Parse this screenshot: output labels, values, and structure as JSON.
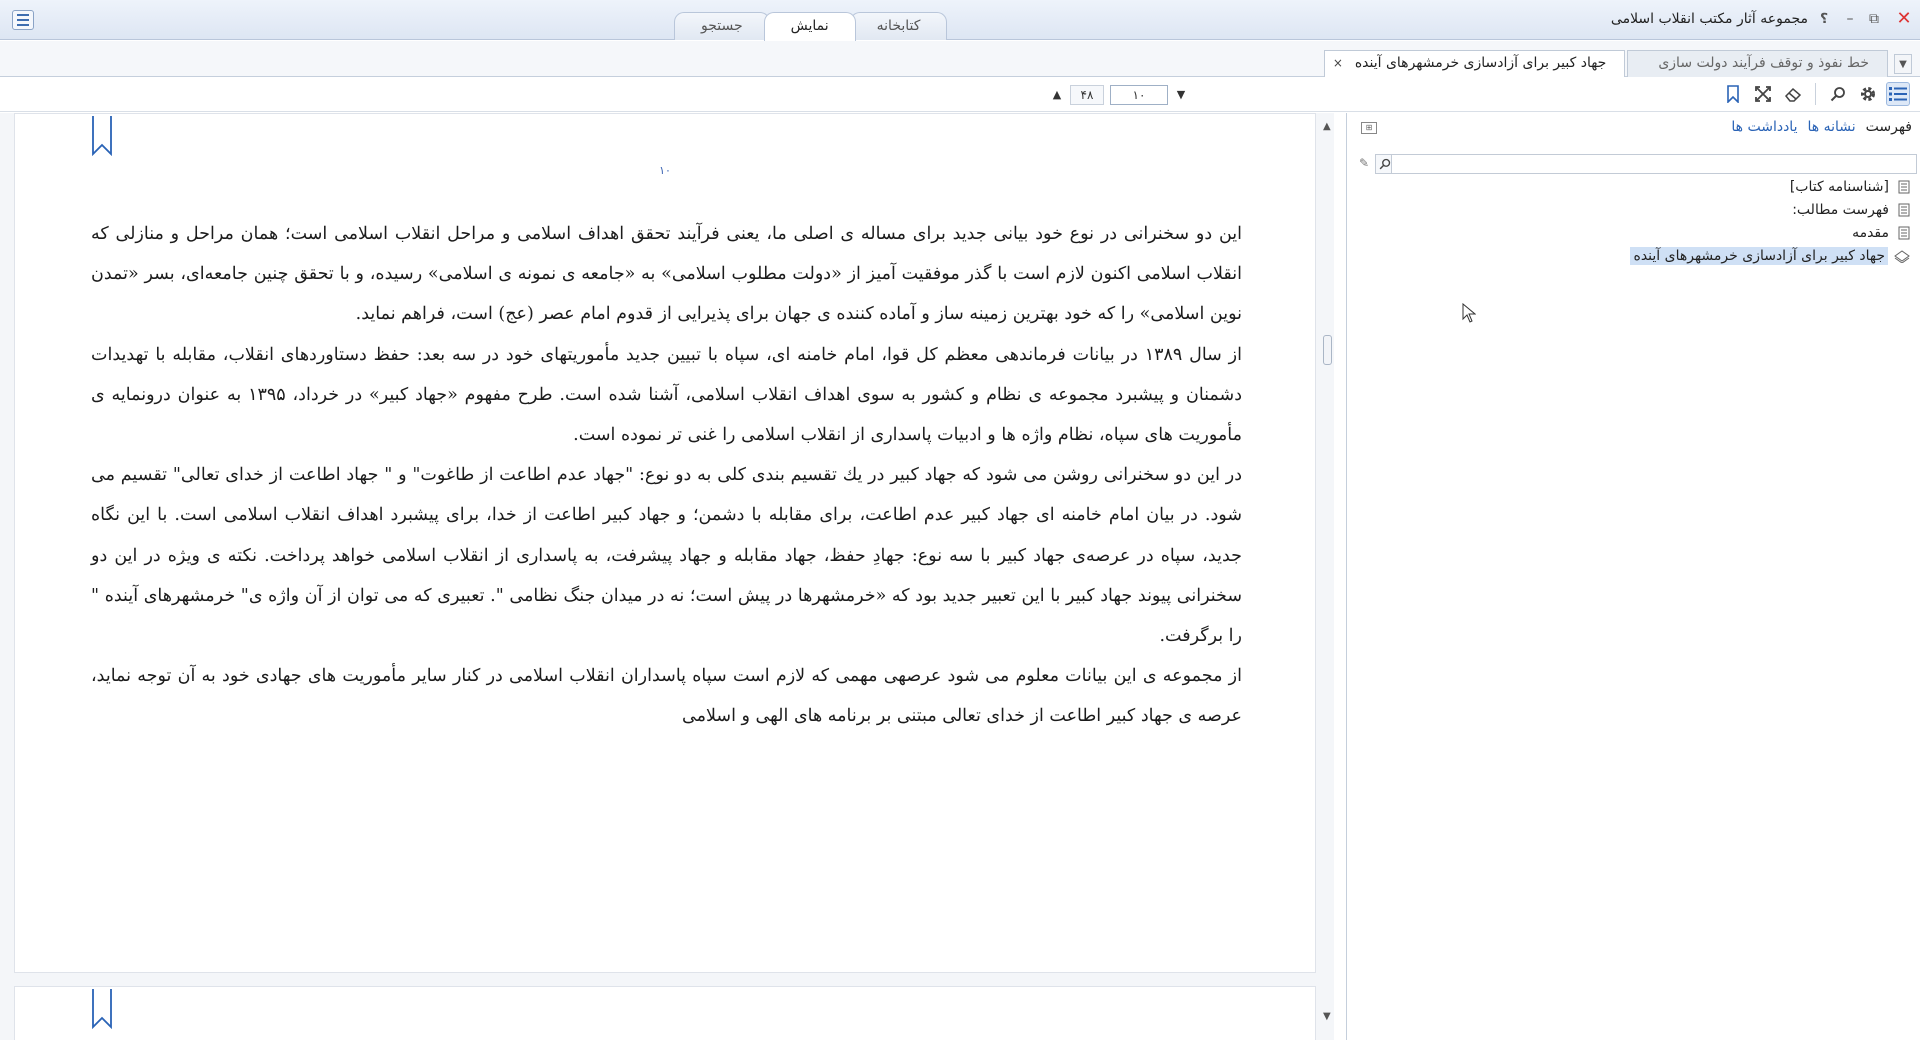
{
  "titlebar": {
    "app_title": "مجموعه آثار مکتب انقلاب اسلامی",
    "tabs": [
      {
        "label": "کتابخانه",
        "active": false
      },
      {
        "label": "نمایش",
        "active": true
      },
      {
        "label": "جستجو",
        "active": false
      }
    ],
    "help_glyph": "؟",
    "minimize_glyph": "–",
    "maximize_glyph": "⧉",
    "close_glyph": "✕"
  },
  "doc_tabs": [
    {
      "label": "جهاد کبیر برای آزادسازی خرمشهرهای آینده",
      "active": true,
      "close": "×"
    },
    {
      "label": "خط نفوذ و توقف فرآیند دولت سازی",
      "active": false,
      "close": ""
    }
  ],
  "toolbar": {
    "page_total": "۴۸",
    "page_current": "۱۰",
    "up_glyph": "▲",
    "down_glyph": "▼"
  },
  "reader": {
    "page_number": "۱۰",
    "paragraphs": [
      "این دو سخنرانی در نوع خود بیانی جدید برای مساله ی اصلی ما، یعنی فرآیند تحقق اهداف اسلامی و مراحل انقلاب اسلامی است؛ همان مراحل و منازلی که انقلاب اسلامی اکنون لازم است با گذر موفقیت آمیز از «دولت مطلوب اسلامی» به «جامعه ی نمونه ی اسلامی» رسیده، و با تحقق چنین جامعه‌ای، بسر «تمدن نوین اسلامی» را که خود بهترین زمینه ساز و آماده کننده ی جهان برای پذیرایی از قدوم امام عصر (عج) است، فراهم نماید.",
      "از سال ۱۳۸۹ در بیانات فرماندهی معظم کل قوا، امام خامنه ای، سپاه با تبیین جدید مأموریتهای خود در سه بعد: حفظ دستاوردهای انقلاب، مقابله با تهدیدات دشمنان و پیشبرد مجموعه ی نظام و کشور به سوی اهداف انقلاب اسلامی، آشنا شده است. طرح مفهوم «جهاد کبیر» در خرداد، ۱۳۹۵ به عنوان درونمایه ی مأموریت های سپاه، نظام واژه ها و ادبیات پاسداری از انقلاب اسلامی را غنی تر نموده است.",
      "در این دو سخنرانی روشن می شود که جهاد کبیر در یك تقسیم بندی کلی به دو نوع: \"جهاد عدم اطاعت از طاغوت\" و \" جهاد اطاعت از خدای تعالی\" تقسیم می شود. در بیان امام خامنه ای جهاد کبیر عدم اطاعت، برای مقابله با دشمن؛ و جهاد کبیر اطاعت از خدا، برای پیشبرد اهداف انقلاب اسلامی است. با این نگاه جدید، سپاه در عرصه‌ی جهاد کبیر با سه نوع: جهادِ حفظ، جهاد مقابله و جهاد پیشرفت، به پاسداری از انقلاب اسلامی خواهد پرداخت. نکته ی ویژه در این دو سخنرانی پیوند جهاد کبیر با این تعبیر جدید بود که «خرمشهرها در پیش است؛ نه در میدان جنگ نظامی \". تعبیری که می توان از آن واژه ی\" خرمشهرهای آینده \" را برگرفت.",
      "از مجموعه ی این بیانات معلوم می شود عرصهی مهمی که لازم است سپاه پاسداران انقلاب اسلامی در کنار سایر مأموریت های جهادی خود به آن توجه نماید، عرصه ی جهاد کبیر اطاعت از خدای تعالی مبتنی بر برنامه های الهی و اسلامی"
    ]
  },
  "sidepanel": {
    "tabs": [
      {
        "label": "فهرست",
        "active": true
      },
      {
        "label": "نشانه ها",
        "active": false
      },
      {
        "label": "یادداشت ها",
        "active": false
      }
    ],
    "search_placeholder": "",
    "toc": [
      {
        "label": "[شناسنامه کتاب]",
        "icon": "document-icon",
        "selected": false
      },
      {
        "label": "فهرست مطالب:",
        "icon": "document-icon",
        "selected": false
      },
      {
        "label": "مقدمه",
        "icon": "document-icon",
        "selected": false
      },
      {
        "label": "جهاد کبیر برای آزادسازی خرمشهرهای آینده",
        "icon": "open-book-icon",
        "selected": true
      }
    ]
  },
  "colors": {
    "accent": "#2a63b6",
    "selection": "#cfe0f5",
    "bookmark": "#2a63b6",
    "close": "#d33333"
  }
}
